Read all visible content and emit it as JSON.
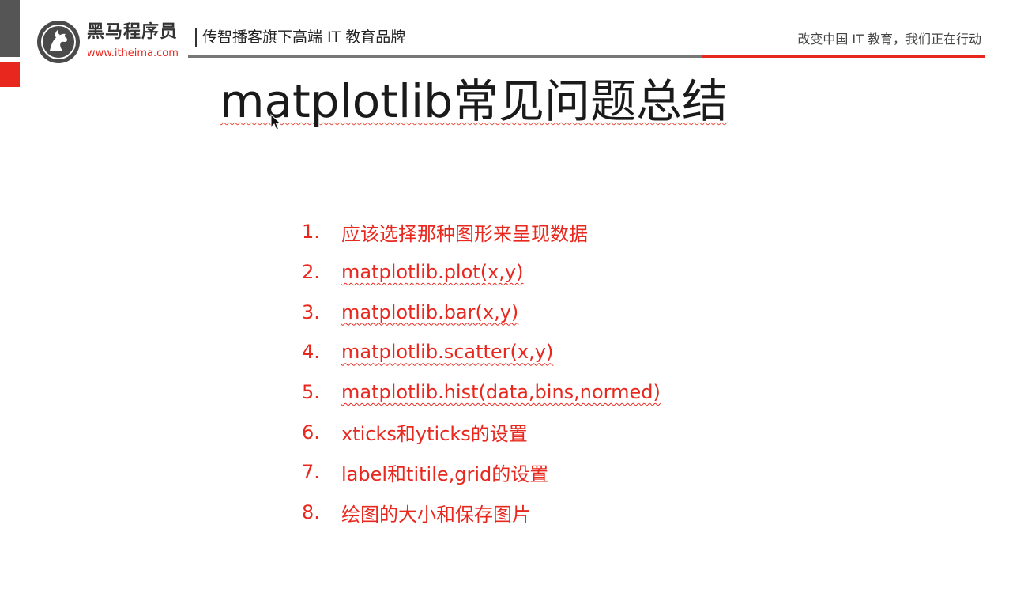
{
  "header": {
    "logo_title": "黑马程序员",
    "logo_url": "www.itheima.com",
    "tagline": "传智播客旗下高端 IT 教育品牌",
    "slogan": "改变中国 IT 教育，我们正在行动"
  },
  "slide": {
    "title": "matplotlib常见问题总结",
    "items": [
      {
        "num": "1.",
        "text": "应该选择那种图形来呈现数据"
      },
      {
        "num": "2.",
        "text": "matplotlib.plot(x,y)"
      },
      {
        "num": "3.",
        "text": "matplotlib.bar(x,y)"
      },
      {
        "num": "4.",
        "text": "matplotlib.scatter(x,y)"
      },
      {
        "num": "5.",
        "text": "matplotlib.hist(data,bins,normed)"
      },
      {
        "num": "6.",
        "text": "xticks和yticks的设置"
      },
      {
        "num": "7.",
        "text": "label和titile,grid的设置"
      },
      {
        "num": "8.",
        "text": "绘图的大小和保存图片"
      }
    ]
  },
  "colors": {
    "accent_red": "#e8281e",
    "accent_dark": "#555555",
    "title_text": "#1a1a1a"
  },
  "icons": {
    "logo": "horse-logo-icon",
    "cursor": "mouse-cursor-icon"
  }
}
